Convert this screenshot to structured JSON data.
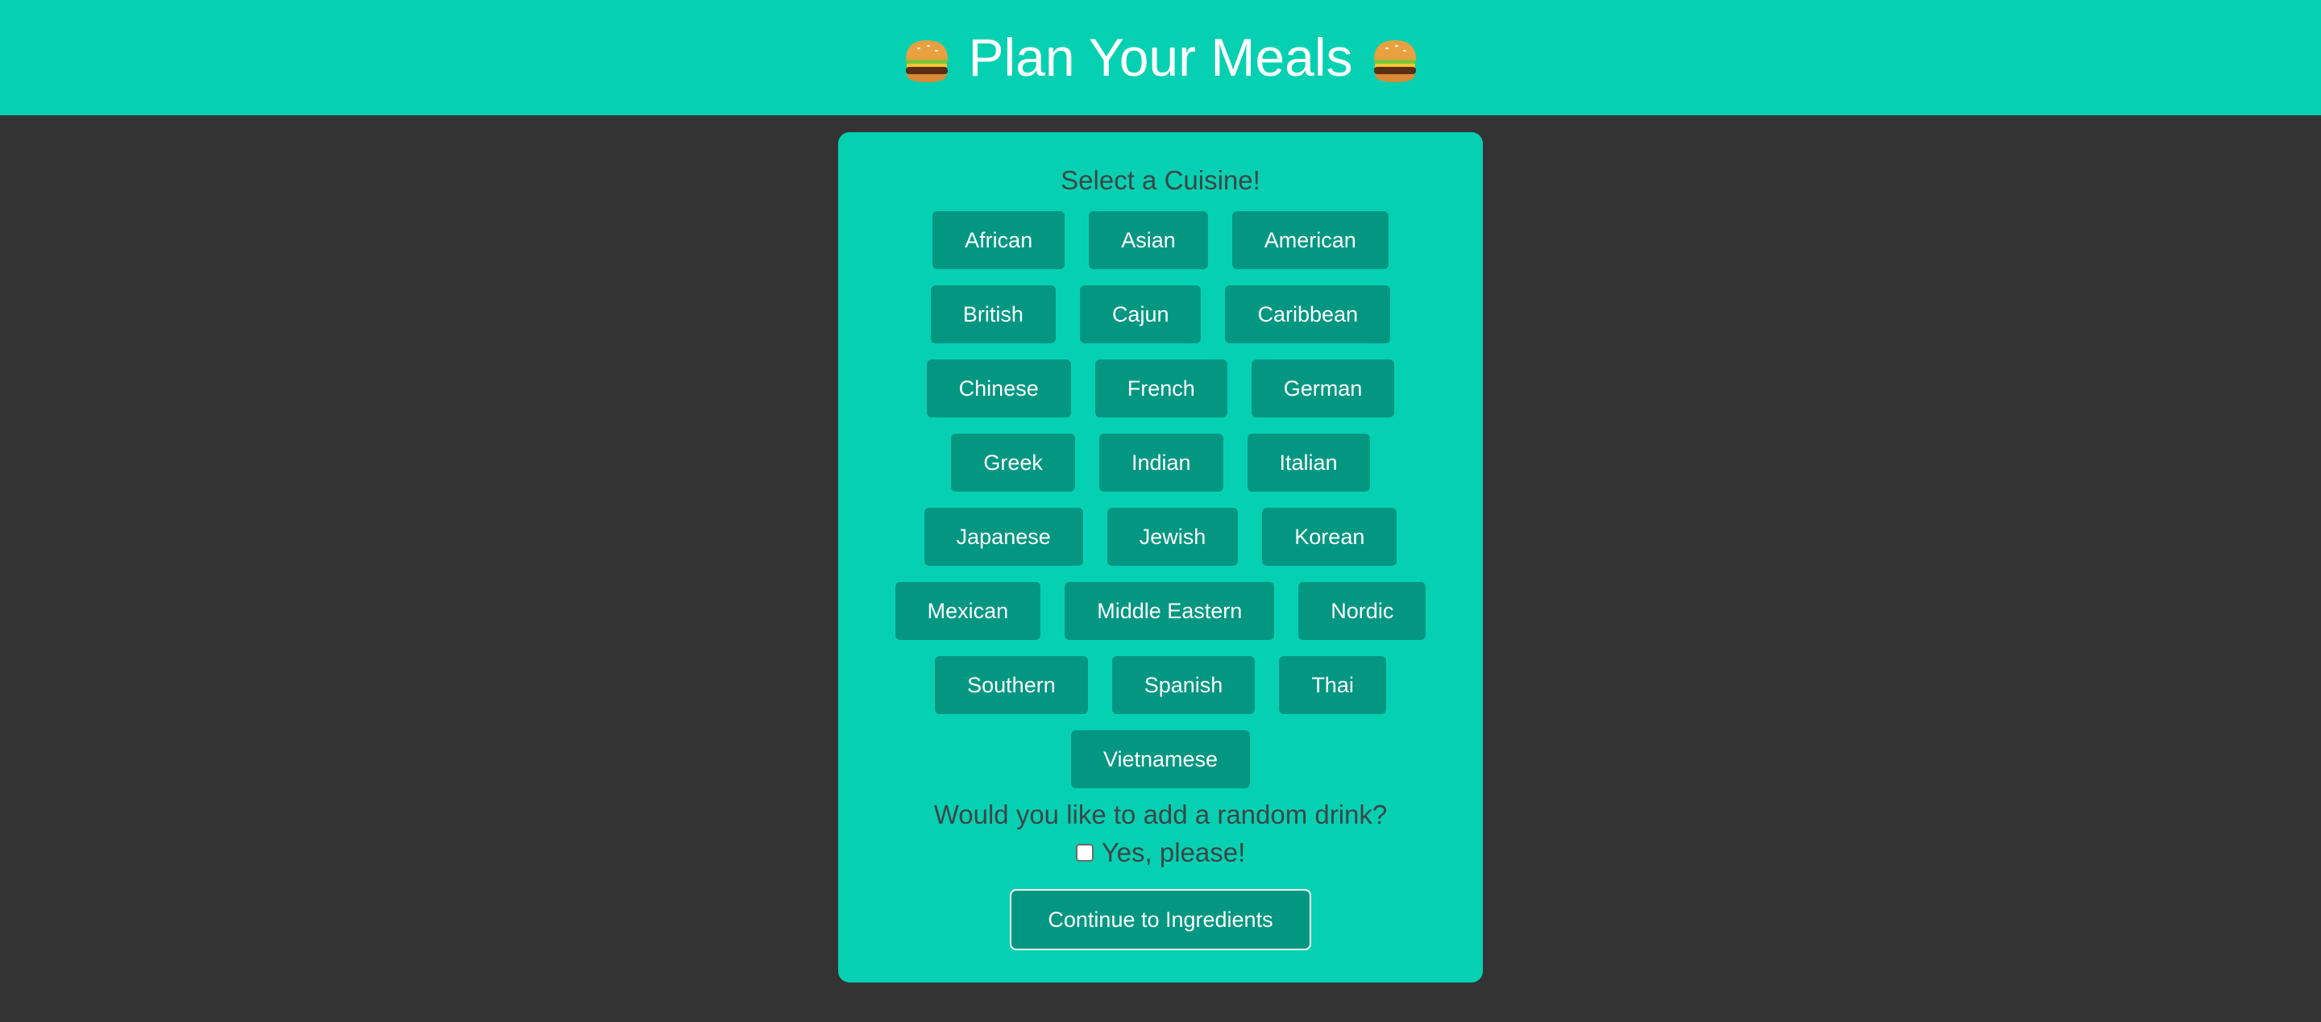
{
  "header": {
    "title": "Plan Your Meals",
    "left_icon": "burger-icon",
    "right_icon": "burger-icon"
  },
  "panel": {
    "title": "Select a Cuisine!",
    "cuisines": [
      "African",
      "Asian",
      "American",
      "British",
      "Cajun",
      "Caribbean",
      "Chinese",
      "French",
      "German",
      "Greek",
      "Indian",
      "Italian",
      "Japanese",
      "Jewish",
      "Korean",
      "Mexican",
      "Middle Eastern",
      "Nordic",
      "Southern",
      "Spanish",
      "Thai",
      "Vietnamese"
    ],
    "drink_question": "Would you like to add a random drink?",
    "drink_checkbox_label": "Yes, please!",
    "drink_checkbox_checked": false,
    "continue_label": "Continue to Ingredients"
  },
  "colors": {
    "accent": "#05d1b2",
    "button": "#039782",
    "background": "#333333",
    "text_dark": "#3d4648"
  }
}
